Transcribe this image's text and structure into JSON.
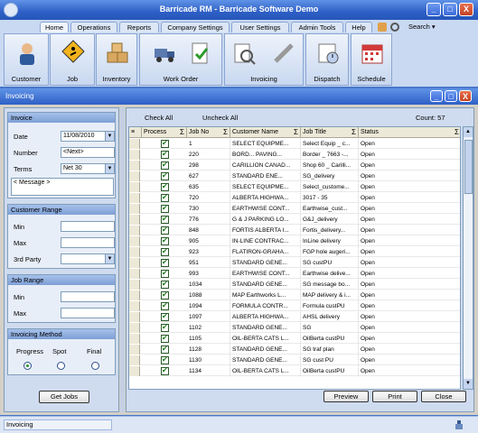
{
  "app": {
    "title": "Barricade RM - Barricade Software Demo"
  },
  "window_buttons": {
    "minimize": "_",
    "maximize": "□",
    "close": "X"
  },
  "tabs": [
    "Home",
    "Operations",
    "Reports",
    "Company Settings",
    "User Settings",
    "Admin Tools",
    "Help"
  ],
  "search_label": "Search ▾",
  "toolbar": [
    {
      "label": "Customer",
      "icon": "customer-icon"
    },
    {
      "label": "Job",
      "icon": "job-sign-icon"
    },
    {
      "label": "Inventory",
      "icon": "inventory-boxes-icon"
    },
    {
      "label": "Work Order",
      "icon": "work-order-icon"
    },
    {
      "label": "Invoicing",
      "icon": "invoicing-icon"
    },
    {
      "label": "Dispatch",
      "icon": "dispatch-icon"
    },
    {
      "label": "Schedule",
      "icon": "calendar-icon"
    }
  ],
  "inner_window": {
    "title": "Invoicing"
  },
  "invoice_group": {
    "title": "Invoice",
    "date_label": "Date",
    "date_value": "11/08/2010",
    "number_label": "Number",
    "number_value": "<Next>",
    "terms_label": "Terms",
    "terms_value": "Net 30",
    "message_placeholder": "< Message >"
  },
  "customer_range": {
    "title": "Customer Range",
    "min_label": "Min",
    "max_label": "Max",
    "third_party_label": "3rd Party"
  },
  "job_range": {
    "title": "Job Range",
    "min_label": "Min",
    "max_label": "Max"
  },
  "invoicing_method": {
    "title": "Invoicing Method",
    "options": [
      "Progress",
      "Spot",
      "Final"
    ],
    "selected": "Progress"
  },
  "get_jobs_label": "Get Jobs",
  "check_all_label": "Check All",
  "uncheck_all_label": "Uncheck All",
  "count_label": "Count:  57",
  "columns": [
    "Process",
    "Job No",
    "Customer Name",
    "Job Title",
    "Status"
  ],
  "sigma": "Σ",
  "rows": [
    {
      "job": "1",
      "customer": "SELECT EQUIPME...",
      "title": "Select Equip _ c...",
      "status": "Open"
    },
    {
      "job": "220",
      "customer": "BORD... PAVING...",
      "title": "Border _ 7663 -...",
      "status": "Open"
    },
    {
      "job": "298",
      "customer": "CARILLION CANAD...",
      "title": "Shop 60 _ Carilli...",
      "status": "Open"
    },
    {
      "job": "627",
      "customer": "STANDARD    ENE...",
      "title": "SG_delivery",
      "status": "Open"
    },
    {
      "job": "635",
      "customer": "SELECT EQUIPME...",
      "title": "Select_custome...",
      "status": "Open"
    },
    {
      "job": "720",
      "customer": "ALBERTA HIGHWA...",
      "title": "3017 - 35",
      "status": "Open"
    },
    {
      "job": "730",
      "customer": "EARTHWISE    CONT...",
      "title": "Earthwise_cust...",
      "status": "Open"
    },
    {
      "job": "776",
      "customer": "G & J PARKING LO...",
      "title": "G&J_delivery",
      "status": "Open"
    },
    {
      "job": "848",
      "customer": "FORTIS ALBERTA I...",
      "title": "Fortis_delivery...",
      "status": "Open"
    },
    {
      "job": "905",
      "customer": "IN-LINE CONTRAC...",
      "title": "InLine delivery",
      "status": "Open"
    },
    {
      "job": "923",
      "customer": "FLATIRON-GRAHA...",
      "title": "FGP hole augeri...",
      "status": "Open"
    },
    {
      "job": "951",
      "customer": "STANDARD GENE...",
      "title": "SG custPU",
      "status": "Open"
    },
    {
      "job": "993",
      "customer": "EARTHWISE  CONT...",
      "title": "Earthwise delive...",
      "status": "Open"
    },
    {
      "job": "1034",
      "customer": "STANDARD  GENE...",
      "title": "SG message bo...",
      "status": "Open"
    },
    {
      "job": "1088",
      "customer": "MAP Earthworks L...",
      "title": "MAP delivery & i...",
      "status": "Open"
    },
    {
      "job": "1094",
      "customer": "FORMULA CONTR...",
      "title": "Formula custPU",
      "status": "Open"
    },
    {
      "job": "1097",
      "customer": "ALBERTA HIGHWA...",
      "title": "AHSL delivery",
      "status": "Open"
    },
    {
      "job": "1102",
      "customer": "STANDARD  GENE...",
      "title": "SG",
      "status": "Open"
    },
    {
      "job": "1105",
      "customer": "OIL-BERTA CATS L...",
      "title": "OilBerta custPU",
      "status": "Open"
    },
    {
      "job": "1128",
      "customer": "STANDARD  GENE...",
      "title": "SG traf plan",
      "status": "Open"
    },
    {
      "job": "1130",
      "customer": "STANDARD  GENE...",
      "title": "SG cust PU",
      "status": "Open"
    },
    {
      "job": "1134",
      "customer": "OIL-BERTA CATS L...",
      "title": "OilBerta custPU",
      "status": "Open"
    }
  ],
  "buttons": {
    "preview": "Preview",
    "print": "Print",
    "close": "Close"
  },
  "statusbar": {
    "text": "Invoicing"
  }
}
